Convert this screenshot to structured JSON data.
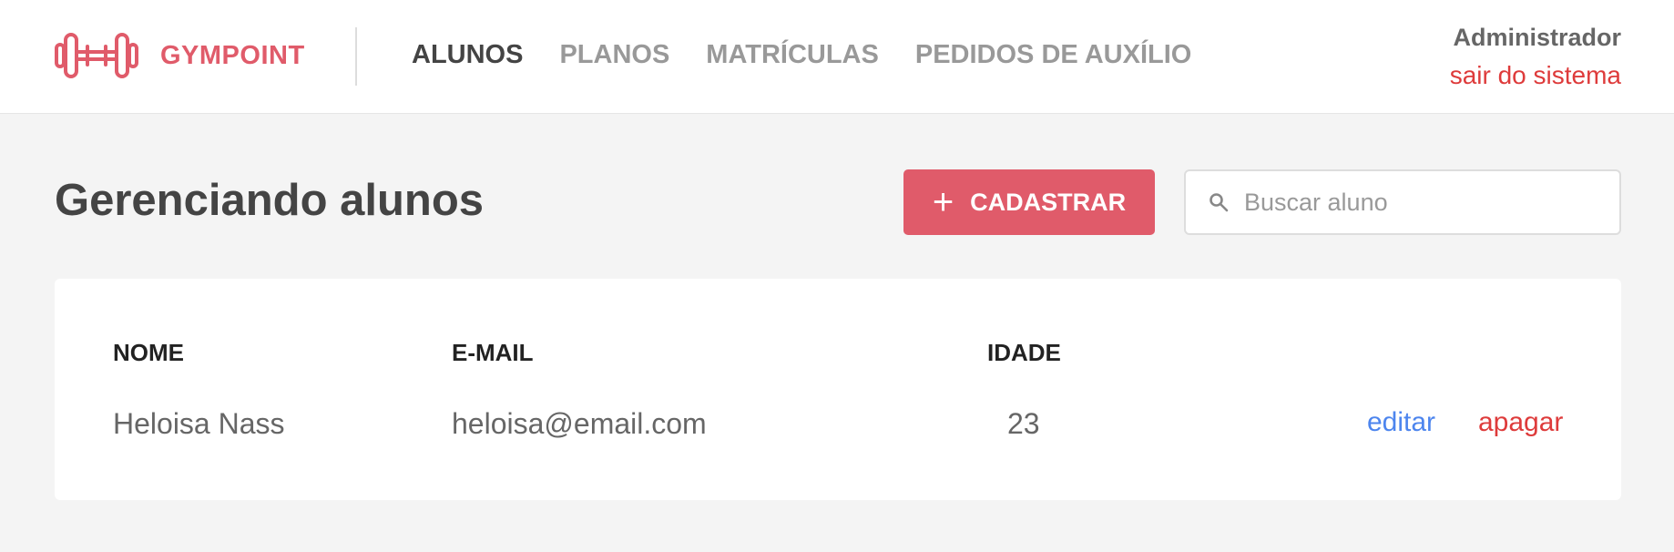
{
  "colors": {
    "brand": "#e05b6a",
    "background": "#f4f4f4",
    "nav_active": "#444444",
    "nav_inactive": "#999999",
    "link_edit": "#4d85ee",
    "link_delete": "#de3b3b"
  },
  "header": {
    "logo_icon": "dumbbell-icon",
    "brand": "GYMPOINT",
    "nav": [
      {
        "label": "ALUNOS",
        "active": true
      },
      {
        "label": "PLANOS",
        "active": false
      },
      {
        "label": "MATRÍCULAS",
        "active": false
      },
      {
        "label": "PEDIDOS DE AUXÍLIO",
        "active": false
      }
    ],
    "user": {
      "name": "Administrador",
      "logout": "sair do sistema"
    }
  },
  "toolbar": {
    "title": "Gerenciando alunos",
    "add_icon": "plus-icon",
    "add_label": "CADASTRAR",
    "search_icon": "search-icon",
    "search_placeholder": "Buscar aluno",
    "search_value": ""
  },
  "table": {
    "headers": {
      "name": "NOME",
      "email": "E-MAIL",
      "age": "IDADE"
    },
    "rows": [
      {
        "name": "Heloisa Nass",
        "email": "heloisa@email.com",
        "age": "23",
        "edit": "editar",
        "delete": "apagar"
      }
    ]
  }
}
